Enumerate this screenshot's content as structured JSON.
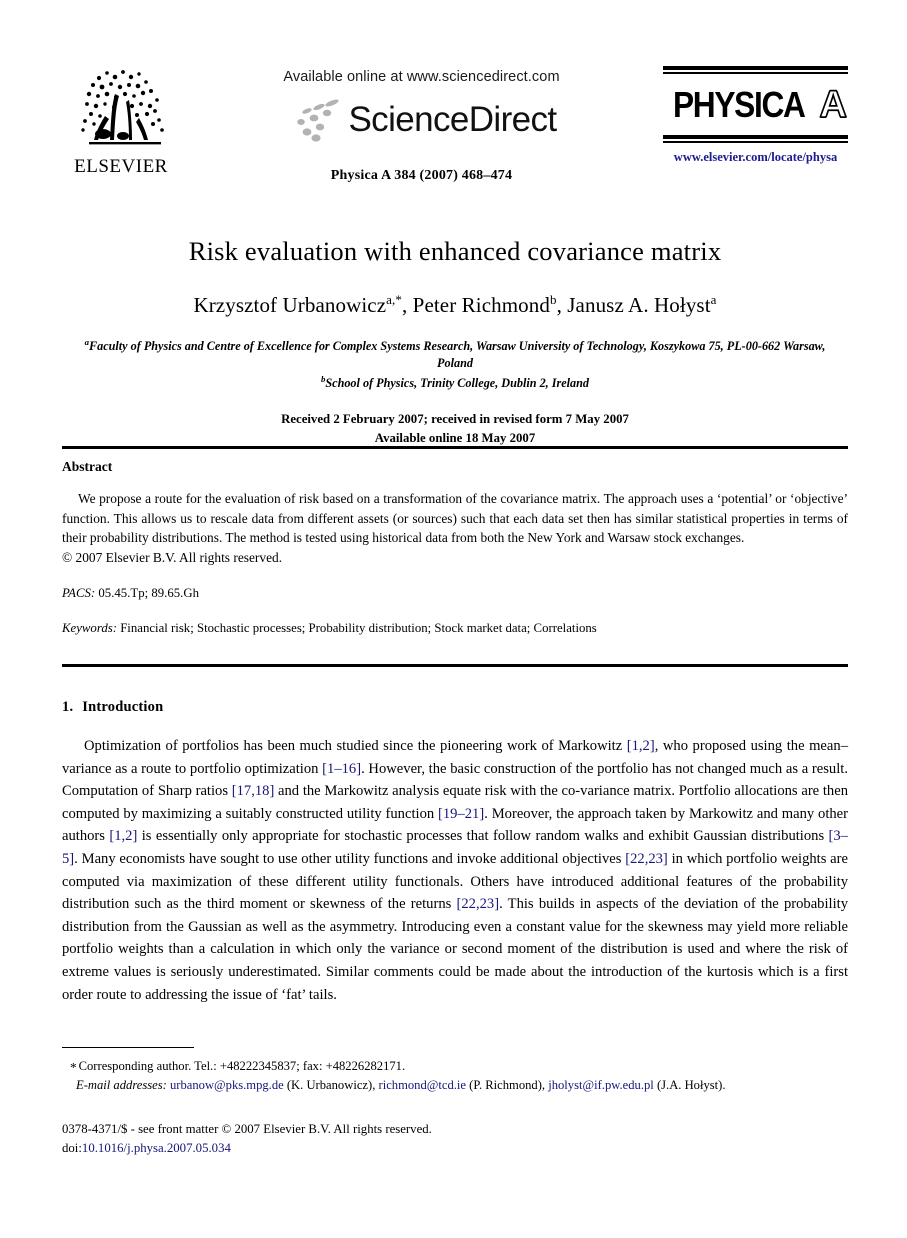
{
  "masthead": {
    "publisher_name": "ELSEVIER",
    "publisher_logo_icon": "elsevier-tree-icon",
    "available_online": "Available online at www.sciencedirect.com",
    "sciencedirect_wordmark": "ScienceDirect",
    "sciencedirect_dots_icon": "sciencedirect-dots-icon",
    "journal_citation": "Physica A 384 (2007) 468–474",
    "journal_logo_main": "PHYSICA",
    "journal_logo_letter": "A",
    "journal_url": "www.elsevier.com/locate/physa"
  },
  "article": {
    "title": "Risk evaluation with enhanced covariance matrix",
    "authors": [
      {
        "name": "Krzysztof Urbanowicz",
        "marks": "a,*"
      },
      {
        "name": "Peter Richmond",
        "marks": "b"
      },
      {
        "name": "Janusz A. Hołyst",
        "marks": "a"
      }
    ],
    "affiliations": [
      {
        "mark": "a",
        "text": "Faculty of Physics and Centre of Excellence for Complex Systems Research, Warsaw University of Technology, Koszykowa 75, PL-00-662 Warsaw, Poland"
      },
      {
        "mark": "b",
        "text": "School of Physics, Trinity College, Dublin 2, Ireland"
      }
    ],
    "received_line": "Received 2 February 2007; received in revised form 7 May 2007",
    "available_line": "Available online 18 May 2007"
  },
  "abstract": {
    "heading": "Abstract",
    "text": "We propose a route for the evaluation of risk based on a transformation of the covariance matrix. The approach uses a ‘potential’ or ‘objective’ function. This allows us to rescale data from different assets (or sources) such that each data set then has similar statistical properties in terms of their probability distributions. The method is tested using historical data from both the New York and Warsaw stock exchanges.",
    "copyright": "© 2007 Elsevier B.V. All rights reserved.",
    "pacs_label": "PACS:",
    "pacs_value": "05.45.Tp; 89.65.Gh",
    "keywords_label": "Keywords:",
    "keywords_value": "Financial risk; Stochastic processes; Probability distribution; Stock market data; Correlations"
  },
  "introduction": {
    "number": "1.",
    "heading": "Introduction",
    "segments": [
      {
        "type": "text",
        "value": "Optimization of portfolios has been much studied since the pioneering work of Markowitz "
      },
      {
        "type": "cite",
        "value": "[1,2]"
      },
      {
        "type": "text",
        "value": ", who proposed using the mean–variance as a route to portfolio optimization "
      },
      {
        "type": "cite",
        "value": "[1–16]"
      },
      {
        "type": "text",
        "value": ". However, the basic construction of the portfolio has not changed much as a result. Computation of Sharp ratios "
      },
      {
        "type": "cite",
        "value": "[17,18]"
      },
      {
        "type": "text",
        "value": " and the Markowitz analysis equate risk with the co-variance matrix. Portfolio allocations are then computed by maximizing a suitably constructed utility function "
      },
      {
        "type": "cite",
        "value": "[19–21]"
      },
      {
        "type": "text",
        "value": ". Moreover, the approach taken by Markowitz and many other authors "
      },
      {
        "type": "cite",
        "value": "[1,2]"
      },
      {
        "type": "text",
        "value": " is essentially only appropriate for stochastic processes that follow random walks and exhibit Gaussian distributions "
      },
      {
        "type": "cite",
        "value": "[3–5]"
      },
      {
        "type": "text",
        "value": ". Many economists have sought to use other utility functions and invoke additional objectives "
      },
      {
        "type": "cite",
        "value": "[22,23]"
      },
      {
        "type": "text",
        "value": " in which portfolio weights are computed via maximization of these different utility functionals. Others have introduced additional features of the probability distribution such as the third moment or skewness of the returns "
      },
      {
        "type": "cite",
        "value": "[22,23]"
      },
      {
        "type": "text",
        "value": ". This builds in aspects of the deviation of the probability distribution from the Gaussian as well as the asymmetry. Introducing even a constant value for the skewness may yield more reliable portfolio weights than a calculation in which only the variance or second moment of the distribution is used and where the risk of extreme values is seriously underestimated. Similar comments could be made about the introduction of the kurtosis which is a first order route to addressing the issue of ‘fat’ tails."
      }
    ]
  },
  "footnotes": {
    "corresponding_marker": "*",
    "corresponding_text": "Corresponding author. Tel.: +48222345837; fax: +48226282171.",
    "email_label": "E-mail addresses:",
    "emails": [
      {
        "address": "urbanow@pks.mpg.de",
        "owner": "(K. Urbanowicz)"
      },
      {
        "address": "richmond@tcd.ie",
        "owner": "(P. Richmond)"
      },
      {
        "address": "jholyst@if.pw.edu.pl",
        "owner": "(J.A. Hołyst)"
      }
    ]
  },
  "imprint": {
    "front_matter": "0378-4371/$ - see front matter © 2007 Elsevier B.V. All rights reserved.",
    "doi_label": "doi:",
    "doi_value": "10.1016/j.physa.2007.05.034"
  },
  "colors": {
    "link": "#16167a",
    "journal_url": "#1b1b8f",
    "text": "#000000",
    "background": "#ffffff"
  }
}
